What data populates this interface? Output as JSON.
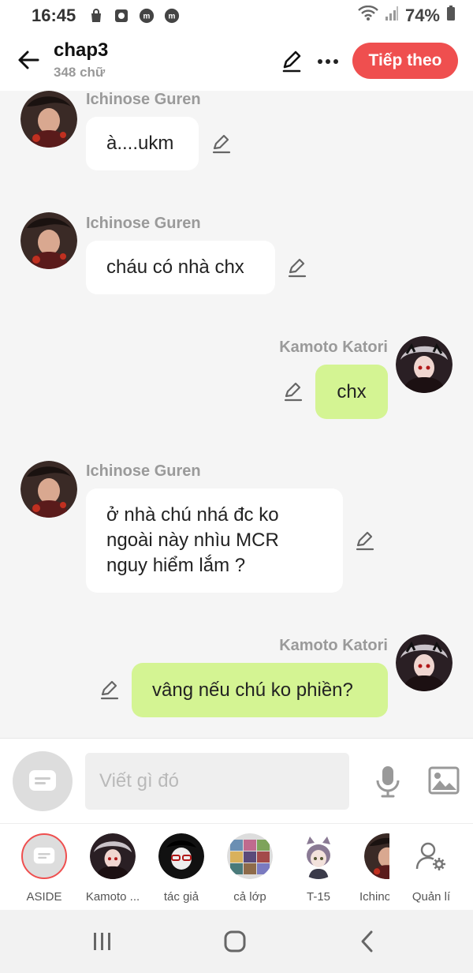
{
  "status_bar": {
    "time": "16:45",
    "battery": "74%"
  },
  "header": {
    "title": "chap3",
    "word_count": "348 chữ",
    "next_label": "Tiếp theo"
  },
  "messages": [
    {
      "sender": "Ichinose Guren",
      "text": "à....ukm",
      "side": "left"
    },
    {
      "sender": "Ichinose Guren",
      "text": "cháu có nhà chx",
      "side": "left"
    },
    {
      "sender": "Kamoto Katori",
      "text": "chx",
      "side": "right"
    },
    {
      "sender": "Ichinose Guren",
      "lines": [
        "ở nhà chú nhá đc ko",
        "ngoài này nhìu MCR",
        "nguy hiểm lắm ?"
      ],
      "side": "left"
    },
    {
      "sender": "Kamoto Katori",
      "text": "vâng nếu chú ko phiền?",
      "side": "right"
    }
  ],
  "input": {
    "placeholder": "Viết gì đó"
  },
  "characters": [
    {
      "label": "ASIDE"
    },
    {
      "label": "Kamoto ..."
    },
    {
      "label": "tác giả"
    },
    {
      "label": "cả lớp"
    },
    {
      "label": "T-15"
    },
    {
      "label": "Ichino"
    },
    {
      "label": "Quản lí"
    }
  ],
  "colors": {
    "accent": "#ef4f4f",
    "my_bubble": "#d4f493",
    "other_bubble": "#ffffff",
    "sender_name": "#9a9a9a"
  }
}
